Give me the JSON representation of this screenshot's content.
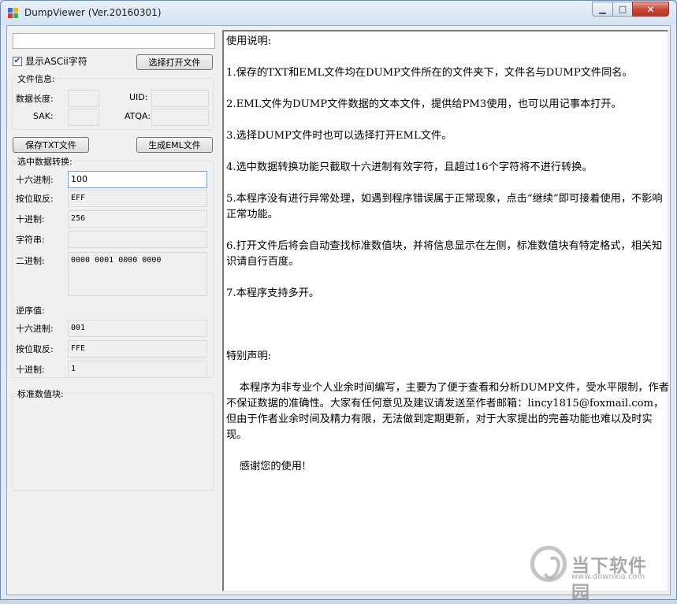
{
  "window": {
    "title": "DumpViewer (Ver.20160301)",
    "min_glyph": "▁",
    "max_glyph": "□",
    "close_glyph": "✕"
  },
  "file": {
    "path_value": "",
    "show_ascii_label": "显示ASCii字符",
    "show_ascii_checked": true,
    "check_glyph": "✔",
    "open_button": "选择打开文件"
  },
  "file_info": {
    "group_label": "文件信息:",
    "data_length_label": "数据长度:",
    "data_length_value": "",
    "uid_label": "UID:",
    "uid_value": "",
    "sak_label": "SAK:",
    "sak_value": "",
    "atqa_label": "ATQA:",
    "atqa_value": ""
  },
  "actions": {
    "save_txt": "保存TXT文件",
    "gen_eml": "生成EML文件"
  },
  "convert": {
    "group_label": "选中数据转换:",
    "hex_label": "十六进制:",
    "hex_value": "100",
    "invert_label": "按位取反:",
    "invert_value": "EFF",
    "dec_label": "十进制:",
    "dec_value": "256",
    "str_label": "字符串:",
    "str_value": "",
    "bin_label": "二进制:",
    "bin_value": "0000 0001 0000 0000"
  },
  "reverse": {
    "section_label": "逆序值:",
    "hex_label": "十六进制:",
    "hex_value": "001",
    "invert_label": "按位取反:",
    "invert_value": "FFE",
    "dec_label": "十进制:",
    "dec_value": "1"
  },
  "standard_block": {
    "group_label": "标准数值块:"
  },
  "readme": {
    "text": "使用说明:\n\n1.保存的TXT和EML文件均在DUMP文件所在的文件夹下，文件名与DUMP文件同名。\n\n2.EML文件为DUMP文件数据的文本文件，提供给PM3使用，也可以用记事本打开。\n\n3.选择DUMP文件时也可以选择打开EML文件。\n\n4.选中数据转换功能只截取十六进制有效字符，且超过16个字符将不进行转换。\n\n5.本程序没有进行异常处理，如遇到程序错误属于正常现象，点击“继续”即可接着使用，不影响正常功能。\n\n6.打开文件后将会自动查找标准数值块，并将信息显示在左侧，标准数值块有特定格式，相关知识请自行百度。\n\n7.本程序支持多开。\n\n\n\n特别声明:\n\n    本程序为非专业个人业余时间编写，主要为了便于查看和分析DUMP文件，受水平限制，作者不保证数据的准确性。大家有任何意见及建议请发送至作者邮箱：lincy1815@foxmail.com，但由于作者业余时间及精力有限，无法做到定期更新，对于大家提出的完善功能也难以及时实现。\n\n    感谢您的使用!"
  },
  "watermark": {
    "name": "当下软件园",
    "url": "www.downxia.com"
  }
}
